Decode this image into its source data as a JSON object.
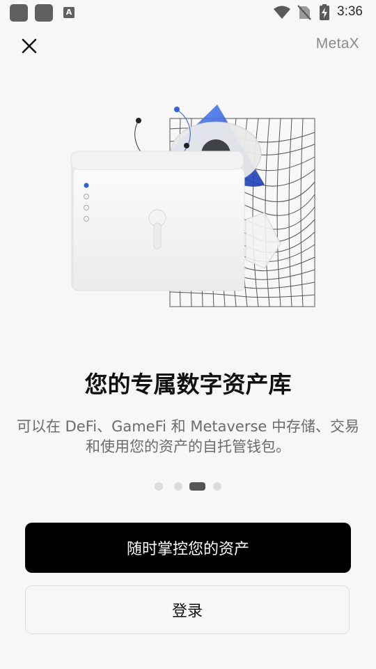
{
  "status_bar": {
    "time": "3:36",
    "notification_icons": [
      "app-icon",
      "app-icon",
      "font-a-icon"
    ],
    "font_icon_letter": "A",
    "system_icons": [
      "wifi-icon",
      "no-sim-icon",
      "battery-charging-icon"
    ]
  },
  "header": {
    "brand": "MetaX"
  },
  "onboarding": {
    "title": "您的专属数字资产库",
    "description": "可以在 DeFi、GameFi 和 Metaverse 中存储、交易和使用您的资产的自托管钱包。",
    "page_count": 4,
    "active_page": 3
  },
  "actions": {
    "primary_label": "随时掌控您的资产",
    "secondary_label": "登录"
  },
  "colors": {
    "background": "#f7f7f7",
    "primary_button": "#000000",
    "accent_blue": "#2f5fe0",
    "muted_text": "#6b6b6b"
  }
}
